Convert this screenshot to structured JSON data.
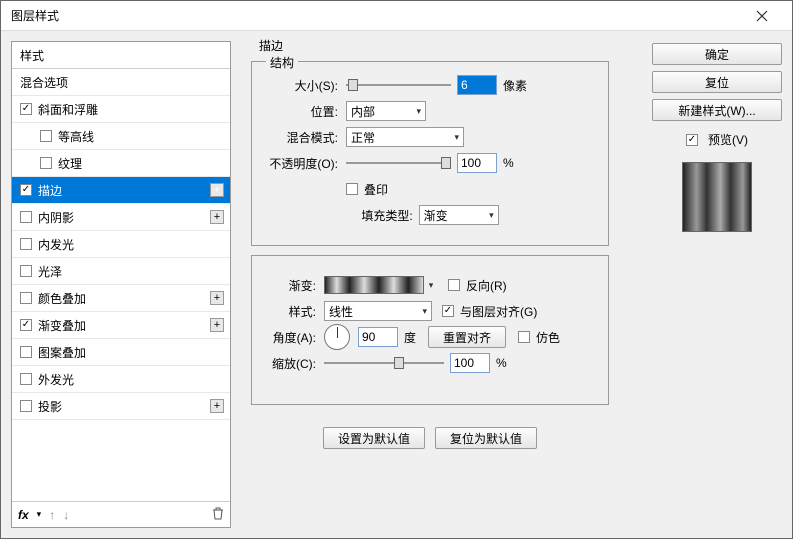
{
  "window": {
    "title": "图层样式"
  },
  "left": {
    "header": "样式",
    "items": [
      {
        "label": "混合选项",
        "checkbox": false,
        "checked": false,
        "sub": false,
        "plus": false
      },
      {
        "label": "斜面和浮雕",
        "checkbox": true,
        "checked": true,
        "sub": false,
        "plus": false
      },
      {
        "label": "等高线",
        "checkbox": true,
        "checked": false,
        "sub": true,
        "plus": false
      },
      {
        "label": "纹理",
        "checkbox": true,
        "checked": false,
        "sub": true,
        "plus": false
      },
      {
        "label": "描边",
        "checkbox": true,
        "checked": true,
        "sub": false,
        "plus": true,
        "selected": true
      },
      {
        "label": "内阴影",
        "checkbox": true,
        "checked": false,
        "sub": false,
        "plus": true
      },
      {
        "label": "内发光",
        "checkbox": true,
        "checked": false,
        "sub": false,
        "plus": false
      },
      {
        "label": "光泽",
        "checkbox": true,
        "checked": false,
        "sub": false,
        "plus": false
      },
      {
        "label": "颜色叠加",
        "checkbox": true,
        "checked": false,
        "sub": false,
        "plus": true
      },
      {
        "label": "渐变叠加",
        "checkbox": true,
        "checked": true,
        "sub": false,
        "plus": true
      },
      {
        "label": "图案叠加",
        "checkbox": true,
        "checked": false,
        "sub": false,
        "plus": false
      },
      {
        "label": "外发光",
        "checkbox": true,
        "checked": false,
        "sub": false,
        "plus": false
      },
      {
        "label": "投影",
        "checkbox": true,
        "checked": false,
        "sub": false,
        "plus": true
      }
    ],
    "fx": "fx"
  },
  "stroke": {
    "section_title": "描边",
    "struct_title": "结构",
    "size_label": "大小(S):",
    "size_value": "6",
    "size_unit": "像素",
    "position_label": "位置:",
    "position_value": "内部",
    "blend_label": "混合模式:",
    "blend_value": "正常",
    "opacity_label": "不透明度(O):",
    "opacity_value": "100",
    "opacity_unit": "%",
    "overprint_label": "叠印",
    "fill_type_label": "填充类型:",
    "fill_type_value": "渐变",
    "gradient_label": "渐变:",
    "reverse_label": "反向(R)",
    "style_label": "样式:",
    "style_value": "线性",
    "align_label": "与图层对齐(G)",
    "angle_label": "角度(A):",
    "angle_value": "90",
    "angle_unit": "度",
    "reset_align": "重置对齐",
    "dither_label": "仿色",
    "scale_label": "缩放(C):",
    "scale_value": "100",
    "scale_unit": "%",
    "set_default": "设置为默认值",
    "reset_default": "复位为默认值"
  },
  "right": {
    "ok": "确定",
    "reset": "复位",
    "new_style": "新建样式(W)...",
    "preview_label": "预览(V)"
  }
}
